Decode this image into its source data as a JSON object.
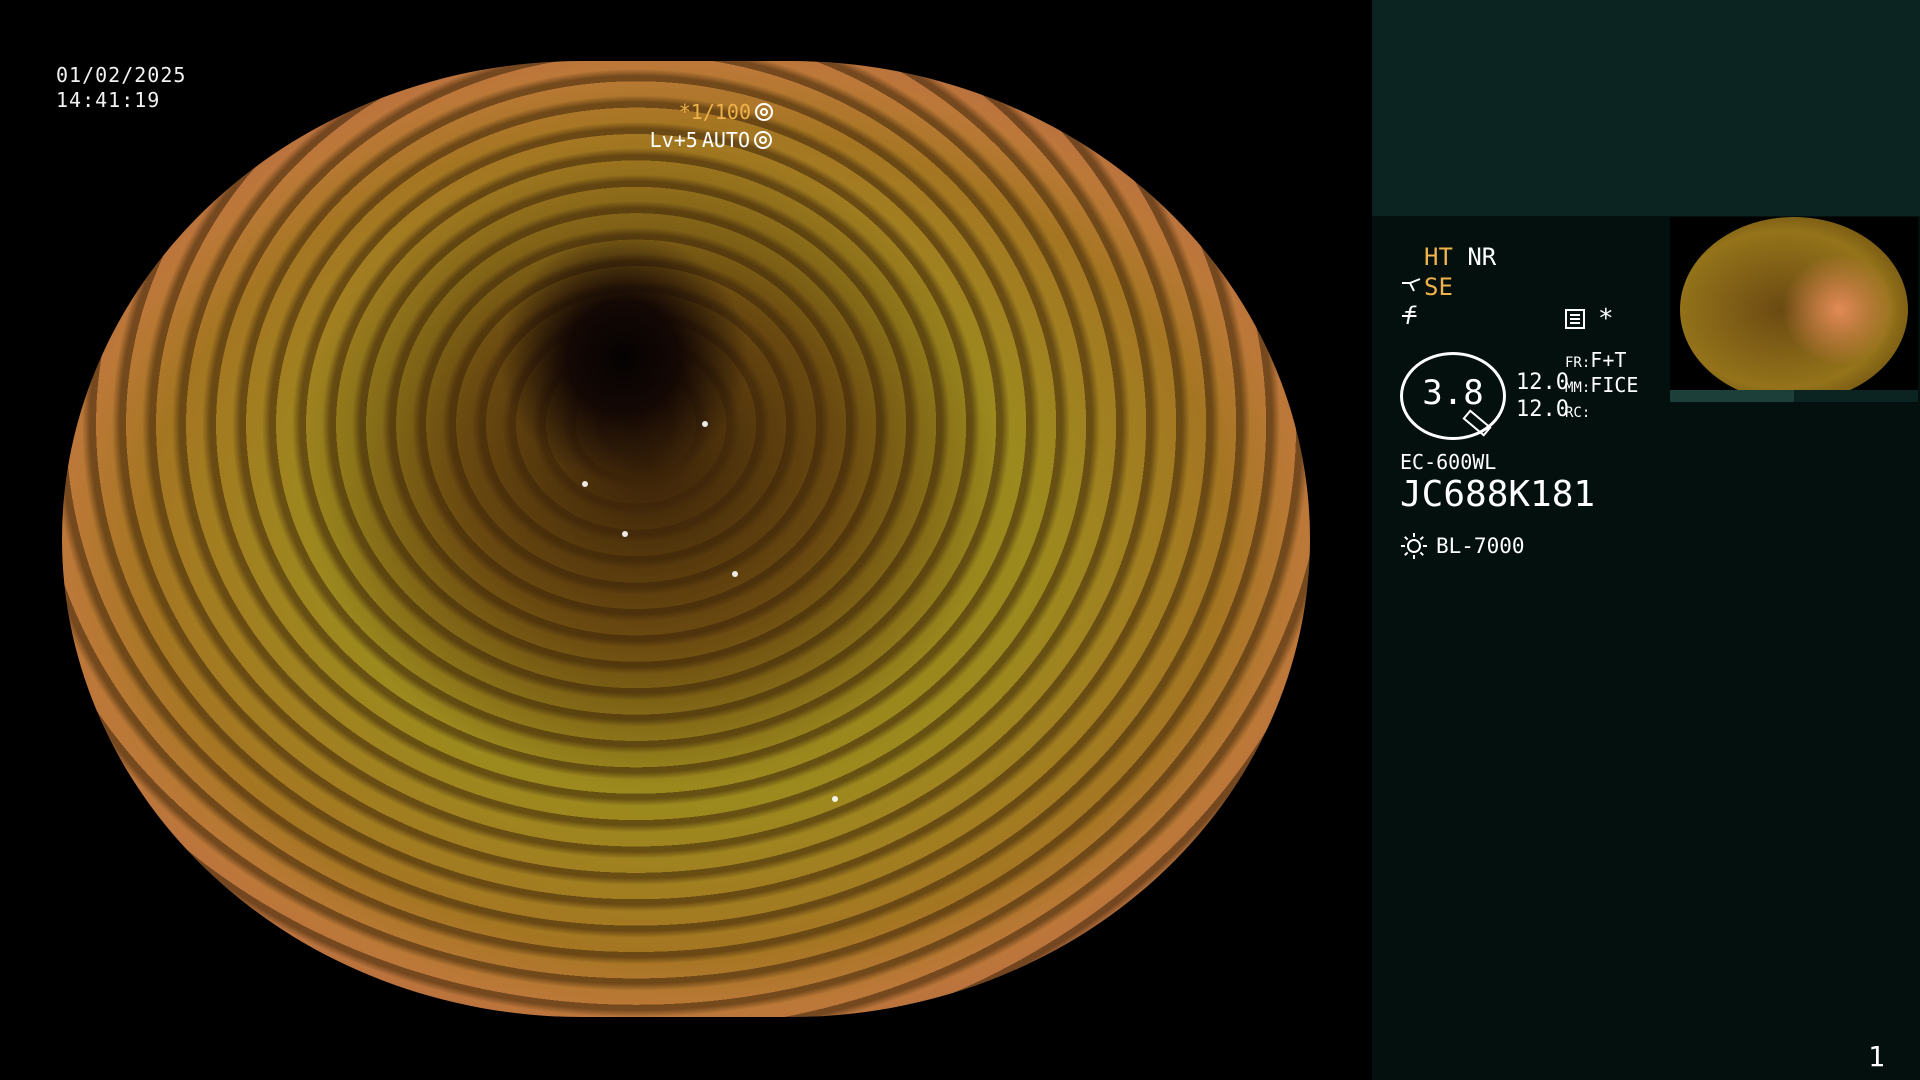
{
  "overlay": {
    "date": "01/02/2025",
    "time": "14:41:19",
    "shutter": "*1/100",
    "level": "Lv+5",
    "iris_mode": "AUTO"
  },
  "panel": {
    "ht": "HT",
    "nr": "NR",
    "se": "SE",
    "f_symbol": "f",
    "asterisk": "*",
    "gauge_value": "3.8",
    "enhance_a": "12.0",
    "enhance_b": "12.0",
    "fr_key": "FR:",
    "fr_value": "F+T",
    "mm_key": "MM:",
    "mm_value": "FICE",
    "rc_key": "RC:",
    "rc_value": "",
    "scope_model": "EC-600WL",
    "scope_serial": "JC688K181",
    "light_source": "BL-7000",
    "page_number": "1"
  },
  "icons": [
    "shutter-icon",
    "iris-icon",
    "scope-icon",
    "freeze-icon",
    "menu-icon",
    "light-icon"
  ],
  "colors": {
    "accent": "#f0b24a",
    "panel_bg": "#03100e",
    "panel_header": "#0b2421"
  }
}
